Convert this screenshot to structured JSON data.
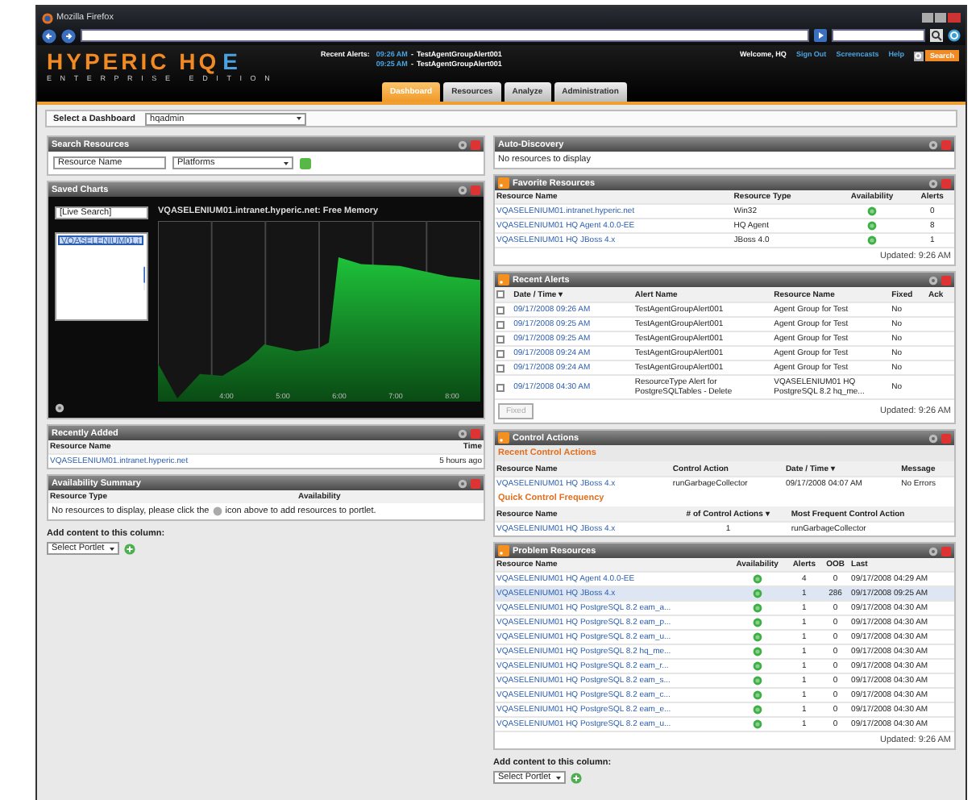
{
  "browser": {
    "title": "Mozilla Firefox"
  },
  "header": {
    "logo": "HYPERIC HQ",
    "logo_badge": "E",
    "edition": "ENTERPRISE EDITION",
    "recent_alerts_label": "Recent Alerts:",
    "recent_alerts": [
      {
        "time": "09:26 AM",
        "separator": "-",
        "name": "TestAgentGroupAlert001"
      },
      {
        "time": "09:25 AM",
        "separator": "-",
        "name": "TestAgentGroupAlert001"
      }
    ],
    "user_links": [
      "Welcome, HQ",
      "Sign Out",
      "Screencasts",
      "Help"
    ],
    "search_button": "Search",
    "tabs": [
      {
        "label": "Dashboard",
        "selected": true
      },
      {
        "label": "Resources",
        "selected": false
      },
      {
        "label": "Analyze",
        "selected": false
      },
      {
        "label": "Administration",
        "selected": false
      }
    ]
  },
  "dashboard_select": {
    "label": "Select a Dashboard",
    "value": "hqadmin"
  },
  "left": [
    {
      "kind": "search",
      "title": "Search Resources",
      "rss": false,
      "name_value": "Resource Name",
      "type_value": "Platforms"
    },
    {
      "kind": "charts",
      "title": "Saved Charts",
      "rss": false,
      "live_search": "[Live Search]",
      "list": [
        {
          "label": "VQASELENIUM01.i",
          "selected": true
        }
      ],
      "chart_title": "VQASELENIUM01.intranet.hyperic.net: Free Memory",
      "x_labels": [
        "4:00",
        "5:00",
        "6:00",
        "7:00",
        "8:00"
      ]
    },
    {
      "kind": "table",
      "title": "Recently Added",
      "rss": false,
      "columns": [
        {
          "label": "Resource Name",
          "kind": "link"
        },
        {
          "label": "Time",
          "kind": "right"
        }
      ],
      "rows": [
        {
          "cells": [
            "VQASELENIUM01.intranet.hyperic.net",
            "5 hours ago"
          ]
        }
      ]
    },
    {
      "kind": "table",
      "title": "Availability Summary",
      "rss": false,
      "columns": [
        {
          "label": "Resource Type",
          "kind": "text"
        },
        {
          "label": "Availability",
          "kind": "text"
        }
      ],
      "message_before": "No resources to display, please click the",
      "message_after": "icon above to add resources to portlet."
    },
    {
      "kind": "add",
      "label": "Add content to this column:",
      "select": "Select Portlet"
    }
  ],
  "right": [
    {
      "kind": "message",
      "title": "Auto-Discovery",
      "rss": false,
      "message": "No resources to display"
    },
    {
      "kind": "table",
      "title": "Favorite Resources",
      "rss": true,
      "columns": [
        {
          "label": "Resource Name",
          "kind": "link"
        },
        {
          "label": "Resource Type",
          "kind": "text"
        },
        {
          "label": "Availability",
          "kind": "status"
        },
        {
          "label": "Alerts",
          "kind": "count"
        }
      ],
      "rows": [
        {
          "cells": [
            "VQASELENIUM01.intranet.hyperic.net",
            "Win32",
            {
              "up": true
            },
            "0"
          ]
        },
        {
          "cells": [
            "VQASELENIUM01 HQ Agent 4.0.0-EE",
            "HQ Agent",
            {
              "up": true
            },
            "8"
          ]
        },
        {
          "cells": [
            "VQASELENIUM01 HQ JBoss 4.x",
            "JBoss 4.0",
            {
              "up": true
            },
            "1"
          ]
        }
      ],
      "footer": "Updated: 9:26 AM"
    },
    {
      "kind": "table",
      "title": "Recent Alerts",
      "rss": true,
      "header_checked": false,
      "columns": [
        {
          "label": "Date / Time ▾",
          "kind": "link"
        },
        {
          "label": "Alert Name",
          "kind": "text"
        },
        {
          "label": "Resource Name",
          "kind": "text"
        },
        {
          "label": "Fixed",
          "kind": "text"
        },
        {
          "label": "Ack",
          "kind": "text"
        }
      ],
      "rows": [
        {
          "checked": false,
          "cells": [
            "09/17/2008 09:26 AM",
            "TestAgentGroupAlert001",
            "Agent Group for Test",
            "No"
          ]
        },
        {
          "checked": false,
          "cells": [
            "09/17/2008 09:25 AM",
            "TestAgentGroupAlert001",
            "Agent Group for Test",
            "No"
          ]
        },
        {
          "checked": false,
          "cells": [
            "09/17/2008 09:25 AM",
            "TestAgentGroupAlert001",
            "Agent Group for Test",
            "No"
          ]
        },
        {
          "checked": false,
          "cells": [
            "09/17/2008 09:24 AM",
            "TestAgentGroupAlert001",
            "Agent Group for Test",
            "No"
          ]
        },
        {
          "checked": false,
          "cells": [
            "09/17/2008 09:24 AM",
            "TestAgentGroupAlert001",
            "Agent Group for Test",
            "No"
          ]
        },
        {
          "checked": false,
          "cells": [
            "09/17/2008 04:30 AM",
            "ResourceType Alert for PostgreSQLTables - Delete",
            "VQASELENIUM01 HQ PostgreSQL 8.2 hq_me...",
            "No"
          ]
        }
      ],
      "button": {
        "label": "Fixed",
        "disabled": true
      },
      "footer": "Updated: 9:26 AM"
    },
    {
      "kind": "sections",
      "title": "Control Actions",
      "rss": true,
      "sections": [
        {
          "subtitle": "Recent Control Actions",
          "columns": [
            {
              "label": "Resource Name",
              "kind": "link"
            },
            {
              "label": "Control Action",
              "kind": "text"
            },
            {
              "label": "Date / Time ▾",
              "kind": "text"
            },
            {
              "label": "Message",
              "kind": "text"
            }
          ],
          "rows": [
            {
              "cells": [
                "VQASELENIUM01 HQ JBoss 4.x",
                "runGarbageCollector",
                "09/17/2008 04:07 AM",
                "No Errors"
              ]
            }
          ]
        },
        {
          "subtitle": "Quick Control Frequency",
          "columns": [
            {
              "label": "Resource Name",
              "kind": "link"
            },
            {
              "label": "# of Control Actions ▾",
              "kind": "count"
            },
            {
              "label": "Most Frequent Control Action",
              "kind": "text"
            }
          ],
          "rows": [
            {
              "cells": [
                "VQASELENIUM01 HQ JBoss 4.x",
                "1",
                "runGarbageCollector"
              ]
            }
          ]
        }
      ]
    },
    {
      "kind": "table",
      "title": "Problem Resources",
      "rss": true,
      "columns": [
        {
          "label": "Resource Name",
          "kind": "link"
        },
        {
          "label": "Availability",
          "kind": "status"
        },
        {
          "label": "Alerts",
          "kind": "count"
        },
        {
          "label": "OOB",
          "kind": "count"
        },
        {
          "label": "Last",
          "kind": "text"
        }
      ],
      "rows": [
        {
          "selected": false,
          "cells": [
            "VQASELENIUM01 HQ Agent 4.0.0-EE",
            {
              "up": true
            },
            "4",
            "0",
            "09/17/2008 04:29 AM"
          ]
        },
        {
          "selected": true,
          "cells": [
            "VQASELENIUM01 HQ JBoss 4.x",
            {
              "up": true
            },
            "1",
            "286",
            "09/17/2008 09:25 AM"
          ]
        },
        {
          "selected": false,
          "cells": [
            "VQASELENIUM01 HQ PostgreSQL 8.2 eam_a...",
            {
              "up": true
            },
            "1",
            "0",
            "09/17/2008 04:30 AM"
          ]
        },
        {
          "selected": false,
          "cells": [
            "VQASELENIUM01 HQ PostgreSQL 8.2 eam_p...",
            {
              "up": true
            },
            "1",
            "0",
            "09/17/2008 04:30 AM"
          ]
        },
        {
          "selected": false,
          "cells": [
            "VQASELENIUM01 HQ PostgreSQL 8.2 eam_u...",
            {
              "up": true
            },
            "1",
            "0",
            "09/17/2008 04:30 AM"
          ]
        },
        {
          "selected": false,
          "cells": [
            "VQASELENIUM01 HQ PostgreSQL 8.2 hq_me...",
            {
              "up": true
            },
            "1",
            "0",
            "09/17/2008 04:30 AM"
          ]
        },
        {
          "selected": false,
          "cells": [
            "VQASELENIUM01 HQ PostgreSQL 8.2 eam_r...",
            {
              "up": true
            },
            "1",
            "0",
            "09/17/2008 04:30 AM"
          ]
        },
        {
          "selected": false,
          "cells": [
            "VQASELENIUM01 HQ PostgreSQL 8.2 eam_s...",
            {
              "up": true
            },
            "1",
            "0",
            "09/17/2008 04:30 AM"
          ]
        },
        {
          "selected": false,
          "cells": [
            "VQASELENIUM01 HQ PostgreSQL 8.2 eam_c...",
            {
              "up": true
            },
            "1",
            "0",
            "09/17/2008 04:30 AM"
          ]
        },
        {
          "selected": false,
          "cells": [
            "VQASELENIUM01 HQ PostgreSQL 8.2 eam_e...",
            {
              "up": true
            },
            "1",
            "0",
            "09/17/2008 04:30 AM"
          ]
        },
        {
          "selected": false,
          "cells": [
            "VQASELENIUM01 HQ PostgreSQL 8.2 eam_u...",
            {
              "up": true
            },
            "1",
            "0",
            "09/17/2008 04:30 AM"
          ]
        }
      ],
      "footer": "Updated: 9:26 AM"
    },
    {
      "kind": "add",
      "label": "Add content to this column:",
      "select": "Select Portlet"
    }
  ]
}
